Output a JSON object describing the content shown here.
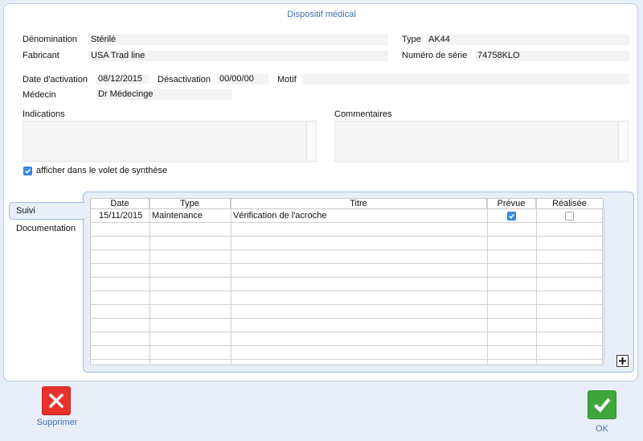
{
  "window": {
    "title": "Dispositif médical"
  },
  "form": {
    "denomination": {
      "label": "Dénomination",
      "value": "Stérilé"
    },
    "type": {
      "label": "Type",
      "value": "AK44"
    },
    "fabricant": {
      "label": "Fabricant",
      "value": "USA Trad line"
    },
    "serial": {
      "label": "Numéro de série",
      "value": "74758KLO"
    },
    "activation": {
      "label": "Date d'activation",
      "value": "08/12/2015"
    },
    "desactivation": {
      "label": "Désactivation",
      "value": "00/00/00"
    },
    "motif": {
      "label": "Motif",
      "value": ""
    },
    "medecin": {
      "label": "Médecin",
      "value": "Dr Médecinge"
    },
    "indications": {
      "label": "Indications",
      "value": ""
    },
    "commentaires": {
      "label": "Commentaires",
      "value": ""
    },
    "synthese": {
      "label": "afficher dans le volet de synthèse",
      "checked": true
    }
  },
  "tabs": [
    {
      "label": "Suivi",
      "active": true
    },
    {
      "label": "Documentation",
      "active": false
    }
  ],
  "grid": {
    "columns": [
      "Date",
      "Type",
      "Titre",
      "Prévue",
      "Réalisée"
    ],
    "rows": [
      {
        "date": "15/11/2015",
        "type": "Maintenance",
        "titre": "Vérification de l'acroche",
        "prevue": true,
        "realisee": false
      }
    ]
  },
  "actions": {
    "delete_label": "Supprimer",
    "ok_label": "OK"
  },
  "colors": {
    "accent": "#3f6fb5",
    "delete": "#e8312c",
    "ok": "#3fa63b",
    "checkbox": "#3d8ee6"
  }
}
